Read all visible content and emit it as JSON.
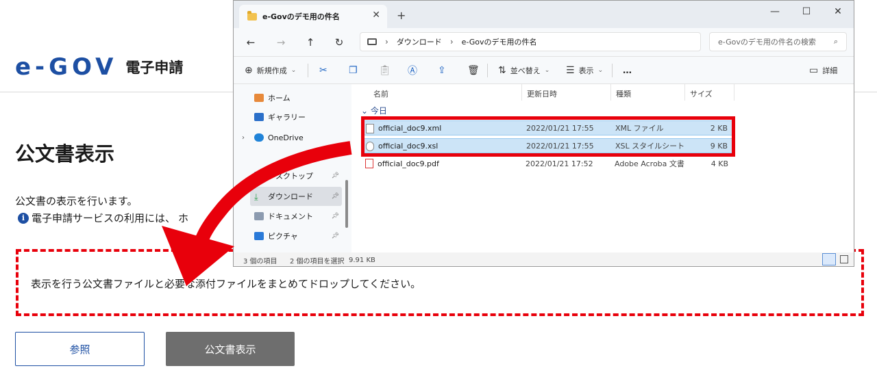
{
  "page": {
    "logo_mark": "e-GOV",
    "logo_sub": "電子申請",
    "title": "公文書表示",
    "description": "公文書の表示を行います。",
    "notice": "電子申請サービスの利用には、",
    "notice_tail": "ホ",
    "drop_text": "表示を行う公文書ファイルと必要な添付ファイルをまとめてドロップしてください。",
    "browse_label": "参照",
    "show_label": "公文書表示"
  },
  "explorer": {
    "tab_title": "e-Govのデモ用の件名",
    "breadcrumb": [
      "ダウンロード",
      "e-Govのデモ用の件名"
    ],
    "search_placeholder": "e-Govのデモ用の件名の検索",
    "toolbar": {
      "new_label": "新規作成",
      "sort_label": "並べ替え",
      "view_label": "表示",
      "more_label": "…",
      "details_label": "詳細"
    },
    "nav": [
      {
        "label": "ホーム",
        "icon": "home-icon"
      },
      {
        "label": "ギャラリー",
        "icon": "gallery-icon"
      },
      {
        "label": "OneDrive",
        "icon": "cloud-icon"
      },
      {
        "label": "デスクトップ",
        "icon": "desktop-icon"
      },
      {
        "label": "ダウンロード",
        "icon": "download-icon"
      },
      {
        "label": "ドキュメント",
        "icon": "document-icon"
      },
      {
        "label": "ピクチャ",
        "icon": "picture-icon"
      }
    ],
    "columns": {
      "name": "名前",
      "date": "更新日時",
      "type": "種類",
      "size": "サイズ"
    },
    "group": "今日",
    "files": [
      {
        "name": "official_doc9.xml",
        "date": "2022/01/21 17:55",
        "type": "XML ファイル",
        "size": "2 KB",
        "selected": true
      },
      {
        "name": "official_doc9.xsl",
        "date": "2022/01/21 17:55",
        "type": "XSL スタイルシート",
        "size": "9 KB",
        "selected": true
      },
      {
        "name": "official_doc9.pdf",
        "date": "2022/01/21 17:52",
        "type": "Adobe Acroba 文書",
        "size": "4 KB",
        "selected": false
      }
    ],
    "status": {
      "count": "3 個の項目",
      "selected": "2 個の項目を選択",
      "size": "9.91 KB"
    }
  },
  "colors": {
    "accent": "#1d4fa3",
    "highlight": "#e8000b",
    "button_gray": "#6e6e6e"
  }
}
